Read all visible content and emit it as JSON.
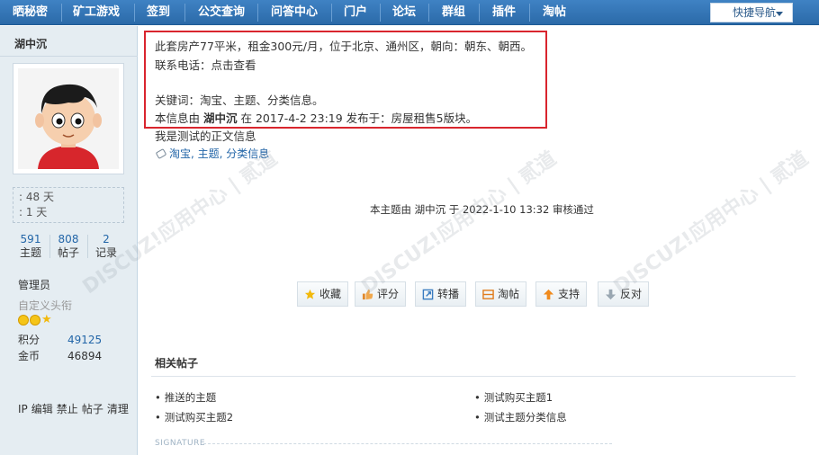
{
  "nav": {
    "items": [
      "晒秘密",
      "矿工游戏",
      "签到",
      "公交查询",
      "问答中心",
      "门户",
      "论坛",
      "群组",
      "插件",
      "淘帖"
    ],
    "active": "论坛",
    "quick_nav": "快捷导航"
  },
  "sidebar": {
    "username": "湖中沉",
    "stat1": ": 48 天",
    "stat2": ": 1 天",
    "counts": [
      {
        "num": "591",
        "label": "主题"
      },
      {
        "num": "808",
        "label": "帖子"
      },
      {
        "num": "2",
        "label": "记录"
      }
    ],
    "role": "管理员",
    "custom_title": "自定义头衔",
    "score_label": "积分",
    "score_value": "49125",
    "gold_label": "金币",
    "gold_value": "46894",
    "admin_links": [
      "IP",
      "编辑",
      "禁止",
      "帖子",
      "清理"
    ]
  },
  "post": {
    "info_line1": "此套房产77平米，租金300元/月，位于北京、通州区，朝向：朝东、朝西。",
    "info_line2": "联系电话：点击查看",
    "keywords": "关键词：淘宝、主题、分类信息。",
    "source_prefix": "本信息由",
    "source_user": "湖中沉",
    "source_suffix": "在 2017-4-2 23:19 发布于：房屋租售5版块。",
    "body": "我是测试的正文信息",
    "tags": "淘宝, 主题, 分类信息",
    "audit": "本主题由 湖中沉 于 2022-1-10 13:32 审核通过"
  },
  "actions": [
    "收藏",
    "评分",
    "转播",
    "淘帖",
    "支持",
    "反对"
  ],
  "related": {
    "title": "相关帖子",
    "items": [
      "推送的主题",
      "测试购买主题1",
      "测试购买主题2",
      "测试主题分类信息"
    ]
  },
  "signature_label": "SIGNATURE",
  "watermark": "DISCUZ!应用中心 | 贰道 addon.dismall.com",
  "colors": {
    "nav": "#2f71b3",
    "link": "#2366a8",
    "highlight": "#d9252e",
    "sidebar": "#e5edf2"
  }
}
